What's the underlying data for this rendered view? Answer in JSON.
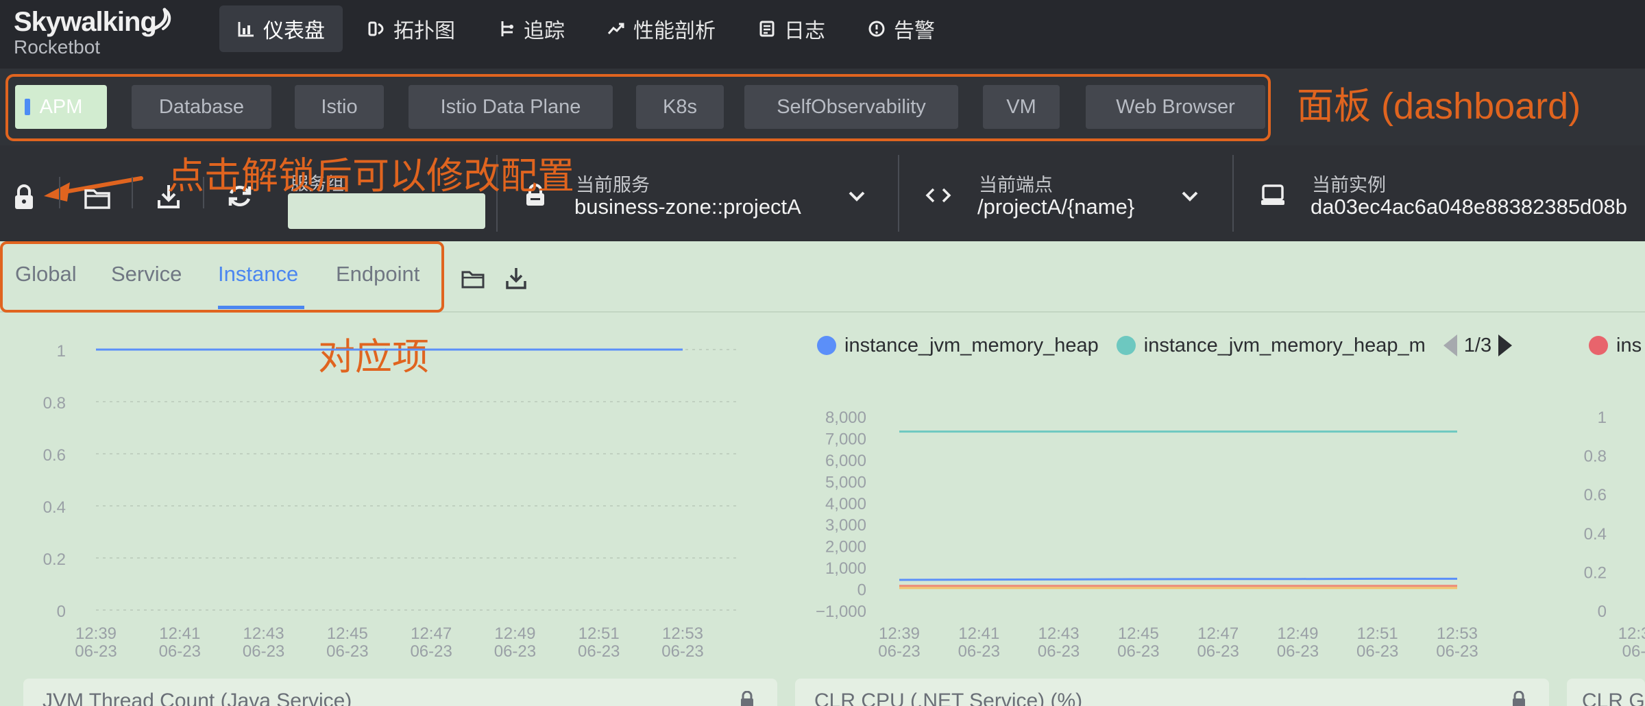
{
  "logo": {
    "name": "Skywalking",
    "sub": "Rocketbot"
  },
  "nav": [
    {
      "label": "仪表盘",
      "icon": "bar-chart-icon",
      "active": true
    },
    {
      "label": "拓扑图",
      "icon": "topology-icon"
    },
    {
      "label": "追踪",
      "icon": "trace-icon"
    },
    {
      "label": "性能剖析",
      "icon": "trend-icon"
    },
    {
      "label": "日志",
      "icon": "log-icon"
    },
    {
      "label": "告警",
      "icon": "alarm-icon"
    }
  ],
  "dashboards": [
    "APM",
    "Database",
    "Istio",
    "Istio Data Plane",
    "K8s",
    "SelfObservability",
    "VM",
    "Web Browser"
  ],
  "annotations": {
    "panel": "面板 (dashboard)",
    "unlock": "点击解锁后可以修改配置",
    "item": "对应项"
  },
  "selector": {
    "group_label": "服务组",
    "group_value": "",
    "service_label": "当前服务",
    "service_value": "business-zone::projectA",
    "endpoint_label": "当前端点",
    "endpoint_value": "/projectA/{name}",
    "instance_label": "当前实例",
    "instance_value": "da03ec4ac6a048e88382385d08b"
  },
  "subtabs": [
    "Global",
    "Service",
    "Instance",
    "Endpoint"
  ],
  "chart_data": [
    {
      "type": "line",
      "x": [
        "12:39\n06-23",
        "12:41\n06-23",
        "12:43\n06-23",
        "12:45\n06-23",
        "12:47\n06-23",
        "12:49\n06-23",
        "12:51\n06-23",
        "12:53\n06-23"
      ],
      "yticks": [
        "1",
        "0.8",
        "0.6",
        "0.4",
        "0.2",
        "0"
      ],
      "ylim": [
        0,
        1
      ],
      "series": [
        {
          "values": [
            1,
            1,
            1,
            1,
            1,
            1,
            1,
            1
          ],
          "color": "#5b8ff9"
        }
      ],
      "grid": true
    },
    {
      "type": "line",
      "x": [
        "12:39\n06-23",
        "12:41\n06-23",
        "12:43\n06-23",
        "12:45\n06-23",
        "12:47\n06-23",
        "12:49\n06-23",
        "12:51\n06-23",
        "12:53\n06-23"
      ],
      "yticks": [
        "8,000",
        "7,000",
        "6,000",
        "5,000",
        "4,000",
        "3,000",
        "2,000",
        "1,000",
        "0",
        "−1,000"
      ],
      "ylim": [
        -1000,
        8000
      ],
      "legend": {
        "items": [
          "instance_jvm_memory_heap",
          "instance_jvm_memory_heap_m"
        ],
        "page": "1/3"
      },
      "series": [
        {
          "name": "instance_jvm_memory_heap",
          "values": [
            400,
            410,
            420,
            430,
            440,
            440,
            450,
            450
          ],
          "color": "#5b8ff9"
        },
        {
          "name": "instance_jvm_memory_heap_m",
          "values": [
            7280,
            7280,
            7280,
            7280,
            7280,
            7280,
            7280,
            7280
          ],
          "color": "#6dc8c0"
        },
        {
          "values": [
            120,
            120,
            120,
            120,
            120,
            120,
            120,
            120
          ],
          "color": "#ee8a76"
        },
        {
          "values": [
            20,
            20,
            20,
            20,
            20,
            20,
            20,
            20
          ],
          "color": "#f2c46e"
        }
      ],
      "grid": false
    },
    {
      "type": "line",
      "x": [
        "12:3\n06-"
      ],
      "yticks": [
        "1",
        "0.8",
        "0.6",
        "0.4",
        "0.2",
        "0"
      ],
      "ylim": [
        0,
        1
      ],
      "legend": {
        "items": [
          "ins"
        ]
      },
      "series": [
        {
          "name": "ins",
          "values": [],
          "color": "#e8646c"
        }
      ],
      "grid": false
    }
  ],
  "cards": [
    "JVM Thread Count (Java Service)",
    "CLR CPU (.NET Service) (%)",
    "CLR G"
  ]
}
